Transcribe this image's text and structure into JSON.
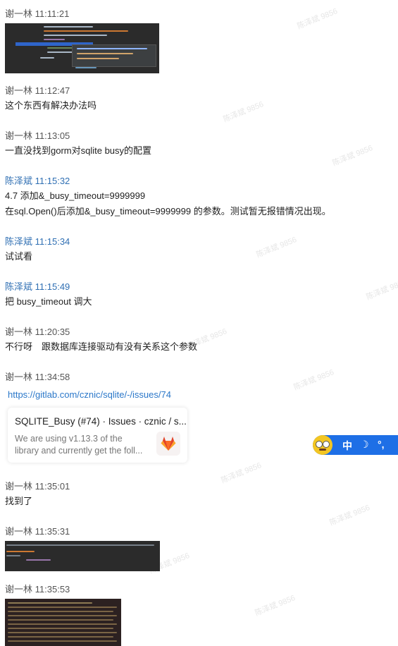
{
  "messages": [
    {
      "id": "m1",
      "sender": "谢一林",
      "time": "11:11:21"
    },
    {
      "id": "m2",
      "sender": "谢一林",
      "time": "11:12:47",
      "lines": [
        "这个东西有解决办法吗"
      ]
    },
    {
      "id": "m3",
      "sender": "谢一林",
      "time": "11:13:05",
      "lines": [
        "一直没找到gorm对sqlite busy的配置"
      ]
    },
    {
      "id": "m4",
      "sender": "陈泽斌",
      "time": "11:15:32",
      "lines": [
        "4.7 添加&_busy_timeout=9999999",
        "在sql.Open()后添加&_busy_timeout=9999999 的参数。测试暂无报错情况出现。"
      ]
    },
    {
      "id": "m5",
      "sender": "陈泽斌",
      "time": "11:15:34",
      "lines": [
        "试试看"
      ]
    },
    {
      "id": "m6",
      "sender": "陈泽斌",
      "time": "11:15:49",
      "lines": [
        "把 busy_timeout 调大"
      ]
    },
    {
      "id": "m7",
      "sender": "谢一林",
      "time": "11:20:35",
      "lines": [
        "不行呀　跟数据库连接驱动有没有关系这个参数"
      ]
    },
    {
      "id": "m8",
      "sender": "谢一林",
      "time": "11:34:58",
      "link": "https://gitlab.com/cznic/sqlite/-/issues/74"
    },
    {
      "id": "m9",
      "sender": "谢一林",
      "time": "11:35:01",
      "lines": [
        "找到了"
      ]
    },
    {
      "id": "m10",
      "sender": "谢一林",
      "time": "11:35:31"
    },
    {
      "id": "m11",
      "sender": "谢一林",
      "time": "11:35:53"
    }
  ],
  "link_card": {
    "title": "SQLITE_Busy (#74) · Issues · cznic / s...",
    "desc_line1": "We are using v1.13.3 of the",
    "desc_line2": "library and currently get the foll..."
  },
  "watermark": "陈泽斌 9856",
  "ime_toolbar": {
    "lang": "中",
    "moon": "☽",
    "punct": "°,"
  }
}
